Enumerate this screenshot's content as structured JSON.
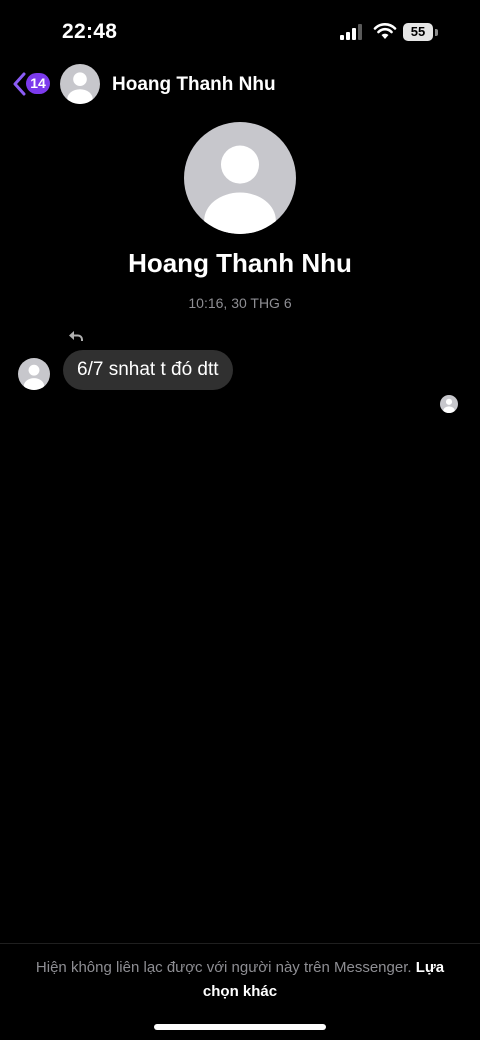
{
  "status_bar": {
    "time": "22:48",
    "battery": "55",
    "icons": [
      "cellular-signal-icon",
      "wifi-icon",
      "battery-icon"
    ]
  },
  "header": {
    "back_badge": "14",
    "name": "Hoang Thanh Nhu",
    "accent_color": "#7c3aed"
  },
  "profile": {
    "name": "Hoang Thanh Nhu"
  },
  "conversation": {
    "timestamp": "10:16, 30 THG 6",
    "messages": [
      {
        "text": "6/7 snhat t đó dtt",
        "from": "contact",
        "forwarded_icon": "reply-arrow-icon"
      }
    ]
  },
  "footer": {
    "notice": "Hiện không liên lạc được với người này trên Messenger.",
    "link": "Lựa chọn khác"
  }
}
